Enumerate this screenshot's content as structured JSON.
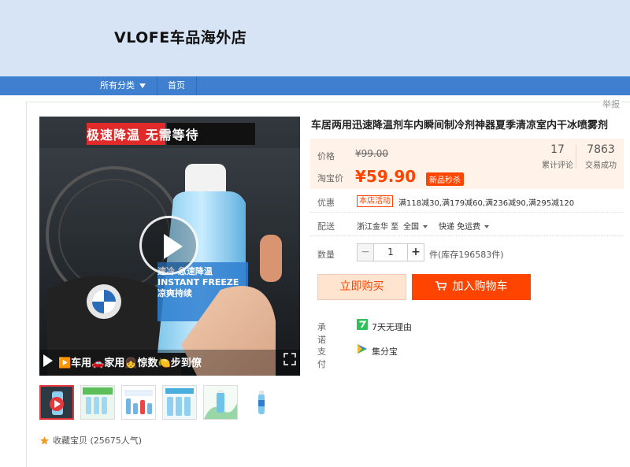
{
  "shop": {
    "name": "VLOFE车品海外店"
  },
  "nav": {
    "categories": "所有分类",
    "home": "首页"
  },
  "report": "举报",
  "product": {
    "title": "车居两用迅速降温剂车内瞬间制冷剂神器夏季清凉室内干冰喷雾剂",
    "video_caption": "▶️车用🚗家用👧惊数🍋步到僚",
    "overlay_text_top": "极速降温 无需等待",
    "bottle_text": "速冷 急速降温 INSTANT FREEZE 凉爽持续"
  },
  "price": {
    "orig_label": "价格",
    "orig_value": "¥99.00",
    "cur_label": "淘宝价",
    "cur_value": "¥59.90",
    "badge": "新品秒杀"
  },
  "stats": [
    {
      "num": "17",
      "label": "累计评论"
    },
    {
      "num": "7863",
      "label": "交易成功"
    }
  ],
  "promo": {
    "label": "优惠",
    "tag": "本店活动",
    "text": "满118减30,满179减60,满236减90,满295减120"
  },
  "shipping": {
    "label": "配送",
    "from": "浙江金华 至",
    "to": "全国",
    "method": "快递 免运费"
  },
  "quantity": {
    "label": "数量",
    "minus": "−",
    "value": "1",
    "plus": "+",
    "stock": "件(库存196583件)"
  },
  "buttons": {
    "buy_now": "立即购买",
    "add_cart": "加入购物车"
  },
  "services": [
    {
      "label": "承诺",
      "icon": "seven-day-return-icon",
      "text": "7天无理由"
    },
    {
      "label": "支付",
      "icon": "jifenbao-icon",
      "text": "集分宝"
    }
  ],
  "favorite": {
    "text": "收藏宝贝 (25675人气)"
  },
  "colors": {
    "nav": "#3f7fd0",
    "header": "#d6e4f5",
    "price": "#ff4400",
    "buy_bg": "#ffe4d0"
  }
}
